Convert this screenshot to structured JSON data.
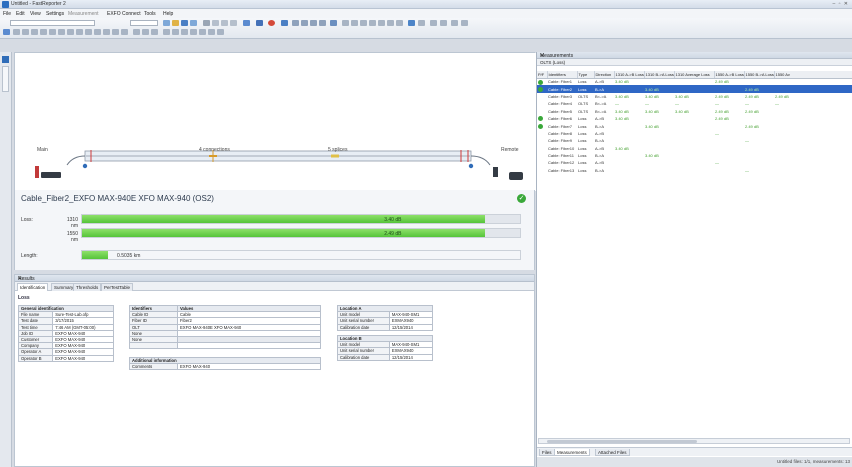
{
  "app": {
    "title": "Untitled - FastReporter 2",
    "window_controls": "‒ ▫ ✕"
  },
  "menu": [
    "File",
    "Edit",
    "View",
    "Settings",
    "Measurement",
    "EXFO Connect",
    "Tools",
    "Help"
  ],
  "toolbar": {
    "combo_value": "",
    "zoom_value": ""
  },
  "link_view": {
    "start_label": "Main",
    "connections_label": "4 connections",
    "splices_label": "5 splices",
    "end_label": "Remote"
  },
  "summary": {
    "fiber_name": "Cable_Fiber2_EXFO MAX-940E XFO MAX-940 (OS2)",
    "loss_label": "Loss:",
    "length_label": "Length:",
    "rows": [
      {
        "wavelength": "1310 nm",
        "value": "3.40 dB",
        "fraction": 0.92
      },
      {
        "wavelength": "1550 nm",
        "value": "2.49 dB",
        "fraction": 0.92
      }
    ],
    "length": {
      "value": "0.5035 km",
      "fraction": 0.06
    }
  },
  "results": {
    "title": "Results",
    "close": "✕",
    "tabs": [
      "Identification",
      "Summary",
      "Thresholds",
      "PerTestTable"
    ],
    "section": "Loss",
    "general": {
      "header": "General identification",
      "rows": [
        [
          "File name",
          "Sure-Test-Lab.ofp"
        ],
        [
          "Test date",
          "3/17/2015"
        ],
        [
          "Test time",
          "7:46 AM (GMT-05:00)"
        ],
        [
          "Job ID",
          "EXFO MAX-940"
        ],
        [
          "Customer",
          "EXFO MAX-940"
        ],
        [
          "Company",
          "EXFO MAX-940"
        ],
        [
          "Operator A",
          "EXFO MAX-940"
        ],
        [
          "Operator B",
          "EXFO MAX-940"
        ]
      ]
    },
    "identifiers": {
      "headers": [
        "Identifiers",
        "Values"
      ],
      "rows": [
        [
          "Cable ID",
          "Cable"
        ],
        [
          "Fiber ID",
          "Fiber2"
        ],
        [
          "OLT",
          "EXFO MAX-940E XFO MAX-940"
        ],
        [
          "None",
          ""
        ],
        [
          "None",
          ""
        ],
        [
          "",
          ""
        ]
      ],
      "additional_header": "Additional information",
      "comments_label": "Comments",
      "comments_value": "EXFO MAX-940"
    },
    "location_a": {
      "header": "Location A",
      "rows": [
        [
          "Unit model",
          "MAX-940-SM1"
        ],
        [
          "Unit serial number",
          "EXMAX940"
        ],
        [
          "Calibration date",
          "12/15/2014"
        ]
      ]
    },
    "location_b": {
      "header": "Location B",
      "rows": [
        [
          "Unit model",
          "MAX-940-SM1"
        ],
        [
          "Unit serial number",
          "EXMAX940"
        ],
        [
          "Calibration date",
          "12/15/2014"
        ]
      ]
    }
  },
  "measurements": {
    "title": "Measurements",
    "close": "✕",
    "subtitle": "OLTS (Loss)",
    "columns": [
      "P/F",
      "Identifiers",
      "Type",
      "Direction",
      "1310 A->B Loss",
      "1310 B->A Loss",
      "1310 Average Loss",
      "1550 A->B Loss",
      "1550 B->A Loss",
      "1550 Av"
    ],
    "rows": [
      {
        "pf": true,
        "id": "Cable: Fiber1",
        "type": "Loss",
        "dir": "A->B",
        "c1": "3.40 dB",
        "c2": "",
        "c3": "",
        "c4": "2.49 dB",
        "c5": "",
        "c6": "",
        "sel": false
      },
      {
        "pf": true,
        "id": "Cable: Fiber2",
        "type": "Loss",
        "dir": "B->A",
        "c1": "",
        "c2": "3.40 dB",
        "c3": "",
        "c4": "",
        "c5": "2.49 dB",
        "c6": "",
        "sel": true
      },
      {
        "pf": false,
        "id": "Cable: Fiber3",
        "type": "OLTS",
        "dir": "B<->A",
        "c1": "3.40 dB",
        "c2": "3.40 dB",
        "c3": "3.40 dB",
        "c4": "2.49 dB",
        "c5": "2.49 dB",
        "c6": "2.49 dB",
        "sel": false
      },
      {
        "pf": false,
        "id": "Cable: Fiber4",
        "type": "OLTS",
        "dir": "B<->A",
        "c1": "—",
        "c2": "—",
        "c3": "—",
        "c4": "—",
        "c5": "—",
        "c6": "—",
        "sel": false
      },
      {
        "pf": false,
        "id": "Cable: Fiber5",
        "type": "OLTS",
        "dir": "B<->A",
        "c1": "3.40 dB",
        "c2": "3.40 dB",
        "c3": "3.40 dB",
        "c4": "2.49 dB",
        "c5": "2.49 dB",
        "c6": "",
        "sel": false
      },
      {
        "pf": true,
        "id": "Cable: Fiber6",
        "type": "Loss",
        "dir": "A->B",
        "c1": "3.40 dB",
        "c2": "",
        "c3": "",
        "c4": "2.49 dB",
        "c5": "",
        "c6": "",
        "sel": false
      },
      {
        "pf": true,
        "id": "Cable: Fiber7",
        "type": "Loss",
        "dir": "B->A",
        "c1": "",
        "c2": "3.40 dB",
        "c3": "",
        "c4": "",
        "c5": "2.49 dB",
        "c6": "",
        "sel": false
      },
      {
        "pf": false,
        "id": "Cable: Fiber8",
        "type": "Loss",
        "dir": "A->B",
        "c1": "",
        "c2": "",
        "c3": "",
        "c4": "—",
        "c5": "",
        "c6": "",
        "sel": false
      },
      {
        "pf": false,
        "id": "Cable: Fiber9",
        "type": "Loss",
        "dir": "B->A",
        "c1": "",
        "c2": "",
        "c3": "",
        "c4": "",
        "c5": "—",
        "c6": "",
        "sel": false
      },
      {
        "pf": false,
        "id": "Cable: Fiber10",
        "type": "Loss",
        "dir": "A->B",
        "c1": "3.40 dB",
        "c2": "",
        "c3": "",
        "c4": "",
        "c5": "",
        "c6": "",
        "sel": false
      },
      {
        "pf": false,
        "id": "Cable: Fiber11",
        "type": "Loss",
        "dir": "B->A",
        "c1": "",
        "c2": "3.40 dB",
        "c3": "",
        "c4": "",
        "c5": "",
        "c6": "",
        "sel": false
      },
      {
        "pf": false,
        "id": "Cable: Fiber12",
        "type": "Loss",
        "dir": "A->B",
        "c1": "",
        "c2": "",
        "c3": "",
        "c4": "—",
        "c5": "",
        "c6": "",
        "sel": false
      },
      {
        "pf": false,
        "id": "Cable: Fiber13",
        "type": "Loss",
        "dir": "B->A",
        "c1": "",
        "c2": "",
        "c3": "",
        "c4": "",
        "c5": "—",
        "c6": "",
        "sel": false
      }
    ],
    "tabs": [
      "Files",
      "Measurements",
      "Attached Files"
    ],
    "status": "Untitled files: 1/1, measurements: 13"
  },
  "colors": {
    "accent": "#2f67c5",
    "pass": "#3aa83a",
    "bar": "#55c43a"
  }
}
